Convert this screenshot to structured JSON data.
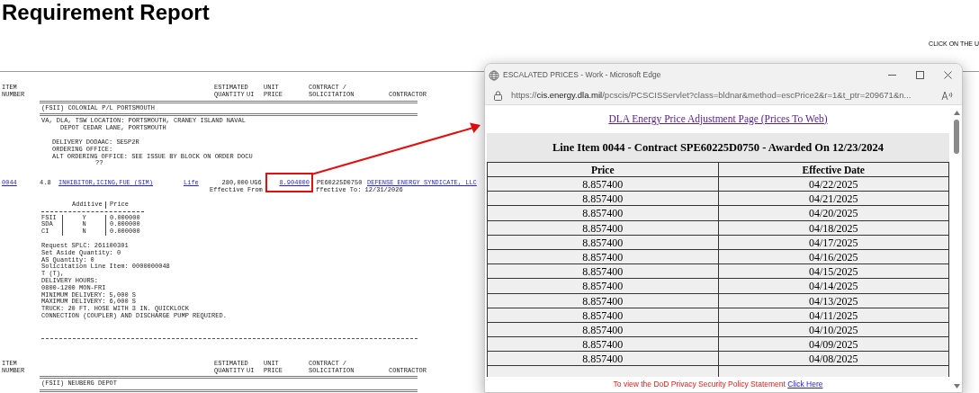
{
  "page": {
    "title": "Requirement Report",
    "hint": "CLICK ON THE U"
  },
  "report": {
    "sections": [
      {
        "columns": [
          {
            "lines": [
              "ITEM",
              "NUMBER"
            ]
          },
          {
            "lines": [
              "ESTIMATED",
              "QUANTITY"
            ]
          },
          {
            "lines": [
              "UI"
            ]
          },
          {
            "lines": [
              "UNIT",
              "PRICE"
            ]
          },
          {
            "lines": [
              "CONTRACT /",
              "SOLICITATION"
            ]
          },
          {
            "lines": [
              "CONTRACTOR"
            ]
          }
        ],
        "depot": "(FSII) COLONIAL P/L PORTSMOUTH",
        "location": [
          "VA, DLA, TSW LOCATION: PORTSMOUTH, CRANEY ISLAND NAVAL",
          "DEPOT CEDAR LANE, PORTSMOUTH"
        ],
        "delivery": [
          "DELIVERY DODAAC: SE5P2R",
          "ORDERING OFFICE:",
          "ALT ORDERING OFFICE: SEE ISSUE BY BLOCK ON ORDER DOCU"
        ],
        "delivery_note": "??",
        "item": {
          "number": "0044",
          "grade": "4.8",
          "description": "INHIBITOR,ICING,FUE (SIM)",
          "life": "Life",
          "quantity": "280,000",
          "unit": "UG6",
          "price": "8.904000",
          "contract": "PE60225D0750",
          "contractor": "DEFENSE ENERGY SYNDICATE, LLC",
          "effective_from": "Effective From",
          "effective_to": "ffective To: 12/31/2026"
        },
        "additives": {
          "heading_additive": "Additive",
          "heading_price": "Price",
          "rows": [
            {
              "name": "FSII",
              "flag": "Y",
              "price": "0.000000"
            },
            {
              "name": "SDA",
              "flag": "N",
              "price": "0.000000"
            },
            {
              "name": "CI",
              "flag": "N",
              "price": "0.000000"
            }
          ]
        },
        "details": [
          "Request SPLC: 261100301",
          "Set Aside Quantity: 0",
          "AS Quantity: 0",
          "Solicitation Line Item: 0000000048",
          "T (T),",
          "DELIVERY HOURS:",
          "0800-1200 MON-FRI",
          "MINIMUM DELIVERY: 5,000 S",
          "MAXIMUM DELIVERY: 6,000 S",
          "TRUCK: 20 FT. HOSE WITH 3 IN. QUICKLOCK",
          "CONNECTION (COUPLER) AND DISCHARGE PUMP REQUIRED."
        ]
      },
      {
        "columns": [
          {
            "lines": [
              "ITEM",
              "NUMBER"
            ]
          },
          {
            "lines": [
              "ESTIMATED",
              "QUANTITY"
            ]
          },
          {
            "lines": [
              "UI"
            ]
          },
          {
            "lines": [
              "UNIT",
              "PRICE"
            ]
          },
          {
            "lines": [
              "CONTRACT /",
              "SOLICITATION"
            ]
          },
          {
            "lines": [
              "CONTRACTOR"
            ]
          }
        ],
        "depot": "(FSII) NEUBERG DEPOT"
      }
    ]
  },
  "popup_window": {
    "title": "ESCALATED PRICES - Work - Microsoft Edge",
    "url": {
      "scheme": "https://",
      "host": "cis.energy.dla.mil",
      "path": "/pcscis/PCSCISServlet?class=bldnar&method=escPrice2&r=1&t_ptr=209671&n..."
    },
    "link": "DLA Energy Price Adjustment Page (Prices To Web)",
    "heading": "Line Item 0044 - Contract SPE60225D0750 - Awarded On 12/23/2024",
    "table": {
      "columns": [
        "Price",
        "Effective Date"
      ],
      "rows": [
        [
          "8.857400",
          "04/22/2025"
        ],
        [
          "8.857400",
          "04/21/2025"
        ],
        [
          "8.857400",
          "04/20/2025"
        ],
        [
          "8.857400",
          "04/18/2025"
        ],
        [
          "8.857400",
          "04/17/2025"
        ],
        [
          "8.857400",
          "04/16/2025"
        ],
        [
          "8.857400",
          "04/15/2025"
        ],
        [
          "8.857400",
          "04/14/2025"
        ],
        [
          "8.857400",
          "04/13/2025"
        ],
        [
          "8.857400",
          "04/11/2025"
        ],
        [
          "8.857400",
          "04/10/2025"
        ],
        [
          "8.857400",
          "04/09/2025"
        ],
        [
          "8.857400",
          "04/08/2025"
        ]
      ]
    },
    "footer": {
      "text": "To view the DoD Privacy Security Policy Statement",
      "link": "Click Here"
    }
  }
}
